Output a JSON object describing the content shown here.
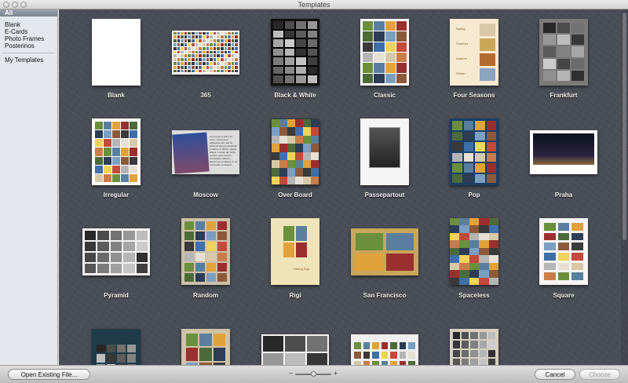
{
  "window": {
    "title": "Templates"
  },
  "sidebar": {
    "selected": "All",
    "groups": [
      [
        "All"
      ],
      [
        "Blank",
        "E-Cards",
        "Photo Frames",
        "Posterinos"
      ],
      [
        "My Templates"
      ]
    ]
  },
  "templates": [
    "Blank",
    "365",
    "Black & White",
    "Classic",
    "Four Seasons",
    "Frankfurt",
    "Irregular",
    "Moscow",
    "Over Board",
    "Passepartout",
    "Pop",
    "Praha",
    "Pyramid",
    "Random",
    "Rigi",
    "San Francisco",
    "Spaceless",
    "Square",
    "",
    "",
    "",
    "",
    ""
  ],
  "thumbs": {
    "moscow_text": "Lorem ipsum dolor sit amet, consectetur adipisicing elit, sed do eiusmod tempor incididunt ut labore et dolore magna aliqua. Ut enim ad minim veniam, quis nostrud exercitation ullamco laboris nisi ut aliquip ex ea commodo consequat.",
    "rigi_caption": "Visiting Rigi",
    "four_seasons": [
      "Spring",
      "Summer",
      "Autumn",
      "Winter"
    ]
  },
  "bottom": {
    "open_label": "Open Existing File...",
    "cancel_label": "Cancel",
    "choose_label": "Choose",
    "zoom_minus": "–",
    "zoom_plus": "+",
    "zoom_level": 0.5
  },
  "colors": {
    "sidebar_bg": "#e4e8ee",
    "grid_bg": "#4a4e57",
    "selection": "#7c858f"
  }
}
